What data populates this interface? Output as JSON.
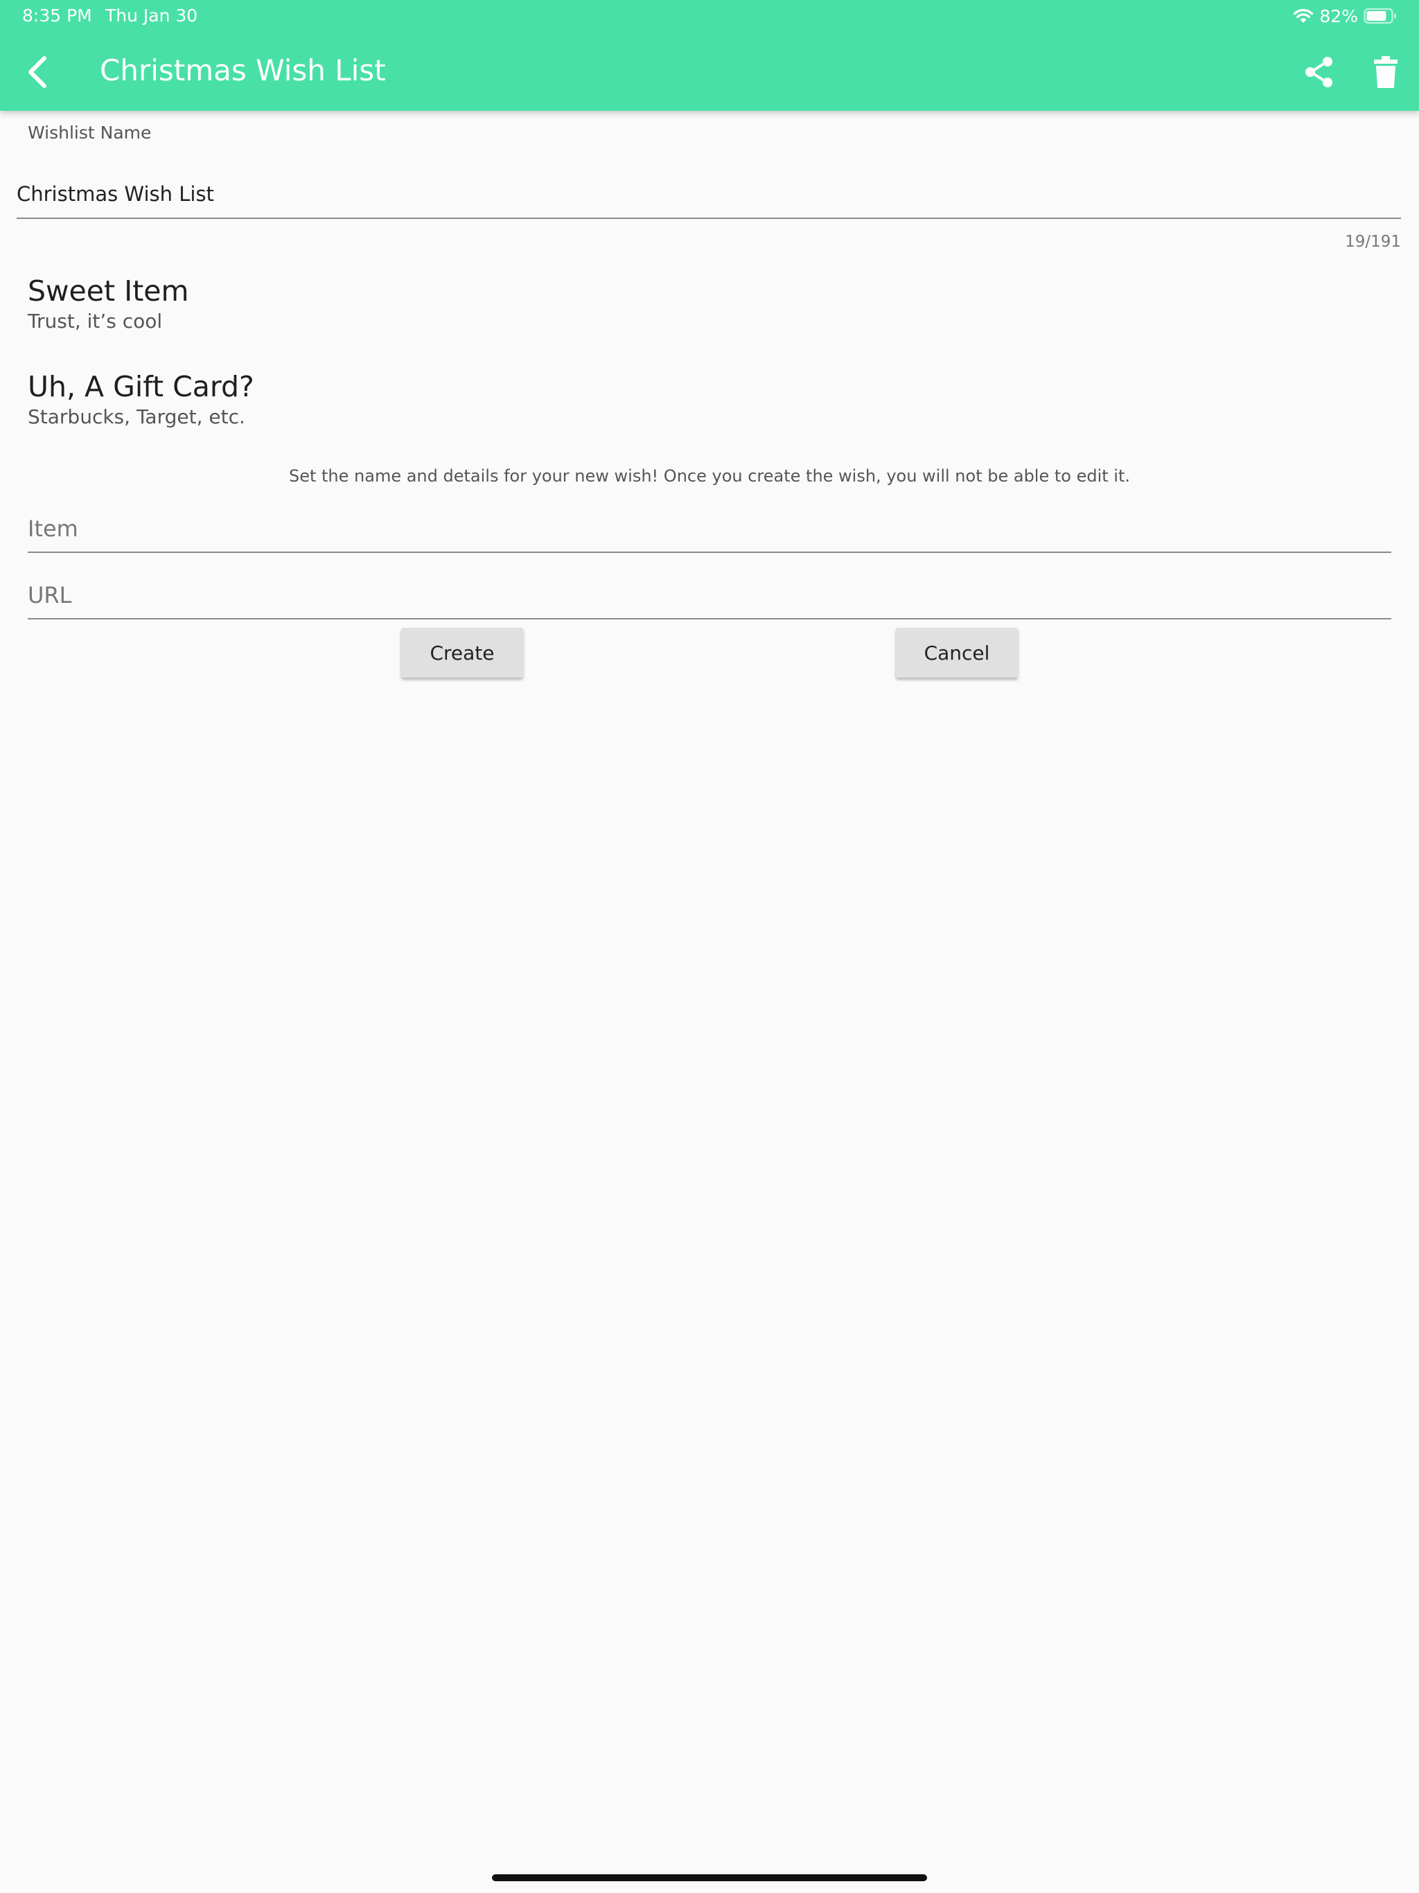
{
  "status_bar": {
    "time": "8:35 PM",
    "date": "Thu Jan 30",
    "battery": "82%",
    "battery_level": 0.82
  },
  "appbar": {
    "title": "Christmas Wish List",
    "color": "#48e0a6",
    "icons": [
      "back-icon",
      "share-icon",
      "trash-icon"
    ]
  },
  "wishlist_name": {
    "label": "Wishlist Name",
    "value": "Christmas Wish List",
    "counter": "19/191"
  },
  "wishes": [
    {
      "title": "Sweet Item",
      "subtitle": "Trust, it’s cool"
    },
    {
      "title": "Uh, A Gift Card?",
      "subtitle": "Starbucks, Target, etc."
    }
  ],
  "new_wish": {
    "instructions": "Set the name and details for your new wish! Once you create the wish, you will not be able to edit it.",
    "item_placeholder": "Item",
    "url_placeholder": "URL",
    "create_label": "Create",
    "cancel_label": "Cancel"
  }
}
